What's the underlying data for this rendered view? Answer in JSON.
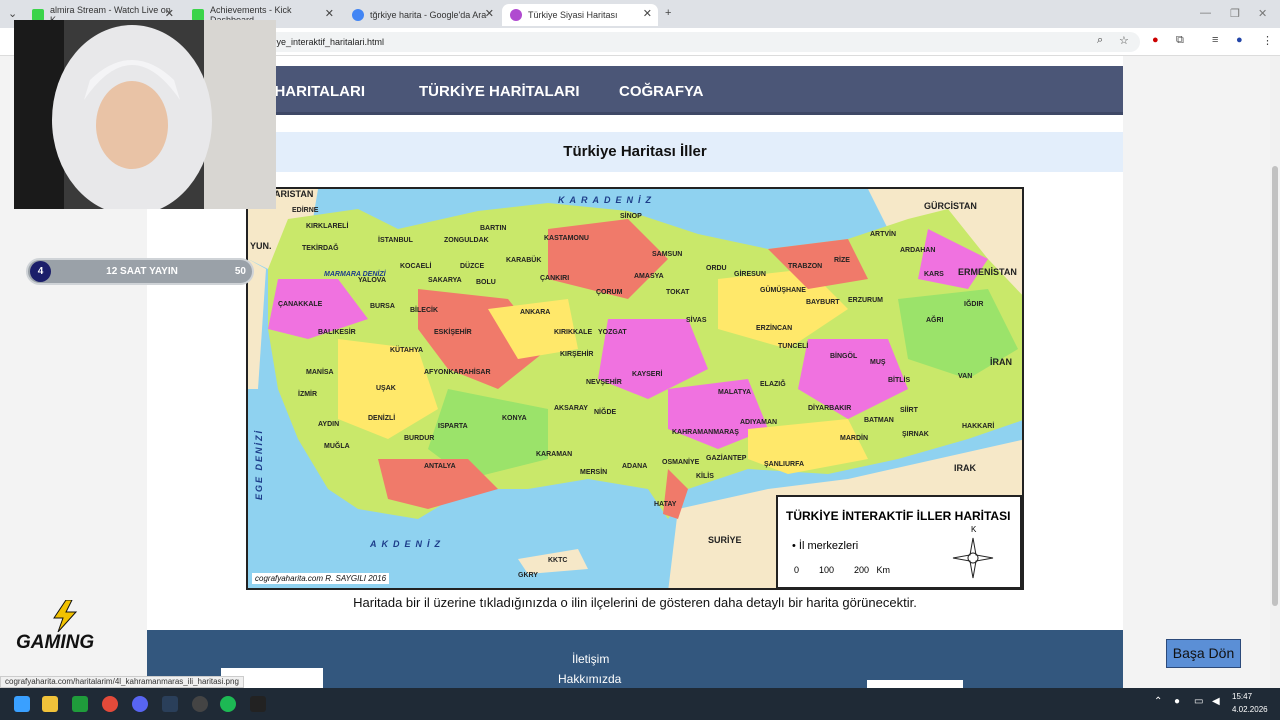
{
  "browser": {
    "tabs": [
      {
        "title": "almira Stream - Watch Live on K",
        "color": "#3bd44a"
      },
      {
        "title": "Achievements - Kick Dashboard",
        "color": "#3bd44a"
      },
      {
        "title": "tğrkiye harita - Google'da Ara",
        "color": "#4285f4"
      },
      {
        "title": "Türkiye Siyasi Haritası",
        "color": "#b04ad0"
      }
    ],
    "url": "kiye_interaktif_haritalari.html"
  },
  "nav": {
    "items": [
      "A HARITALARI",
      "TÜRKİYE HARİTALARI",
      "COĞRAFYA"
    ]
  },
  "heading": "Türkiye Haritası İller",
  "map": {
    "seas": {
      "north": "KARADENİZ",
      "south": "AKDENİZ",
      "west": "EGE DENİZİ",
      "marmara": "MARMARA DENİZİ"
    },
    "countries": [
      "GÜRCİSTAN",
      "ERMENİSTAN",
      "İRAN",
      "IRAK",
      "SURİYE",
      "YUN.",
      "ARISTAN",
      "KKTC",
      "GKRY"
    ],
    "provinces": [
      "EDİRNE",
      "KIRKLARELİ",
      "TEKİRDAĞ",
      "İSTANBUL",
      "ÇANAKKALE",
      "BALIKESİR",
      "BURSA",
      "YALOVA",
      "KOCAELİ",
      "SAKARYA",
      "DÜZCE",
      "ZONGULDAK",
      "BARTIN",
      "KASTAMONU",
      "SİNOP",
      "SAMSUN",
      "ORDU",
      "GİRESUN",
      "TRABZON",
      "RİZE",
      "ARTVİN",
      "ARDAHAN",
      "KARS",
      "IĞDIR",
      "AĞRI",
      "ERZURUM",
      "BAYBURT",
      "GÜMÜŞHANE",
      "TOKAT",
      "AMASYA",
      "ÇORUM",
      "ÇANKIRI",
      "KARABÜK",
      "BOLU",
      "BİLECİK",
      "ESKİŞEHİR",
      "KÜTAHYA",
      "ANKARA",
      "KIRIKKALE",
      "YOZGAT",
      "SİVAS",
      "ERZİNCAN",
      "TUNCELİ",
      "BİNGÖL",
      "MUŞ",
      "VAN",
      "BİTLİS",
      "SİİRT",
      "HAKKARİ",
      "ŞIRNAK",
      "BATMAN",
      "MARDİN",
      "DİYARBAKIR",
      "ELAZIĞ",
      "MALATYA",
      "ADIYAMAN",
      "ŞANLIURFA",
      "GAZİANTEP",
      "KİLİS",
      "OSMANİYE",
      "HATAY",
      "ADANA",
      "MERSİN",
      "KARAMAN",
      "NİĞDE",
      "NEVŞEHİR",
      "KIRŞEHİR",
      "AKSARAY",
      "KAYSERİ",
      "KAHRAMANMARAŞ",
      "KONYA",
      "ANTALYA",
      "BURDUR",
      "ISPARTA",
      "AFYONKARAHİSAR",
      "UŞAK",
      "MANİSA",
      "İZMİR",
      "AYDIN",
      "MUĞLA",
      "DENİZLİ"
    ],
    "legend": {
      "title": "TÜRKİYE İNTERAKTİF İLLER HARİTASI",
      "bullet": "İl merkezleri",
      "scale": "0        100        200   Km",
      "compass": "K"
    },
    "credit": "cografyaharita.com  R. SAYGILI 2016"
  },
  "caption": "Haritada bir il üzerine tıkladığınızda o ilin ilçelerini de gösteren daha detaylı bir harita görünecektir.",
  "footer": {
    "links": [
      "İletişim",
      "Hakkımızda"
    ]
  },
  "back_to_top": "Başa Dön",
  "status_url": "cografyaharita.com/haritalarim/4l_kahramanmaras_ili_haritasi.png",
  "overlay": {
    "pill_left": "4",
    "pill_text": "12 SAAT YAYIN",
    "pill_right": "50",
    "brand": "GAMING"
  },
  "taskbar": {
    "time": "15:47",
    "date": "4.02.2026"
  }
}
